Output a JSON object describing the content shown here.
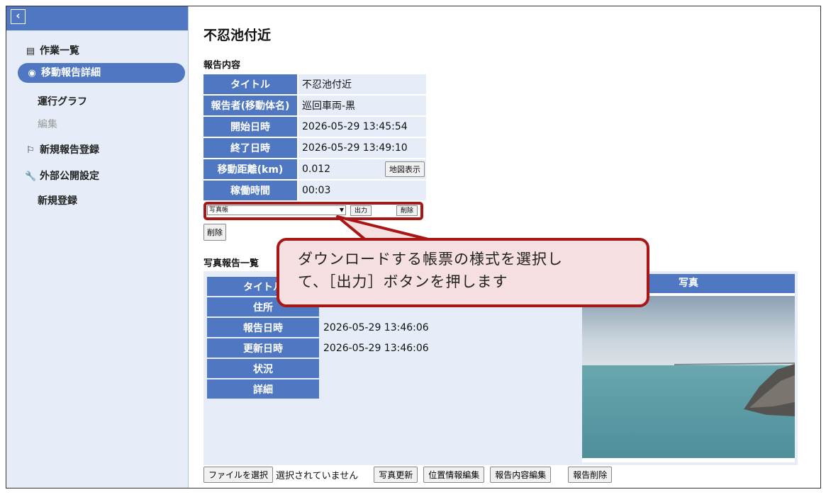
{
  "sidebar": {
    "back_icon": "chevron-left-icon",
    "items": [
      {
        "label": "作業一覧",
        "icon": "list-icon"
      },
      {
        "label": "移動報告詳細",
        "icon": "globe-icon"
      },
      {
        "label": "運行グラフ"
      },
      {
        "label": "編集"
      },
      {
        "label": "新規報告登録",
        "icon": "flag-icon"
      },
      {
        "label": "外部公開設定",
        "icon": "wrench-icon"
      },
      {
        "label": "新規登録"
      }
    ]
  },
  "page": {
    "title": "不忍池付近"
  },
  "report": {
    "section_title": "報告内容",
    "rows": [
      {
        "key": "タイトル",
        "value": "不忍池付近"
      },
      {
        "key": "報告者(移動体名)",
        "value": "巡回車両-黒"
      },
      {
        "key": "開始日時",
        "value": "2026-05-29 13:45:54"
      },
      {
        "key": "終了日時",
        "value": "2026-05-29 13:49:10"
      },
      {
        "key": "移動距離(km)",
        "value": "0.012"
      },
      {
        "key": "稼働時間",
        "value": "00:03"
      }
    ],
    "map_button": "地図表示"
  },
  "export": {
    "selected": "写真帳",
    "output_button": "出力",
    "delete_button": "削除"
  },
  "delete_button": "削除",
  "photo_report": {
    "section_title": "写真報告一覧",
    "rows": [
      {
        "key": "タイトル",
        "value": ""
      },
      {
        "key": "住所",
        "value": ""
      },
      {
        "key": "報告日時",
        "value": "2026-05-29 13:46:06"
      },
      {
        "key": "更新日時",
        "value": "2026-05-29 13:46:06"
      },
      {
        "key": "状況",
        "value": ""
      },
      {
        "key": "詳細",
        "value": ""
      }
    ],
    "photo_header": "写真"
  },
  "bottom": {
    "choose_file": "ファイルを選択",
    "file_status": "選択されていません",
    "update_photo": "写真更新",
    "edit_location": "位置情報編集",
    "edit_report": "報告内容編集",
    "delete_report": "報告削除"
  },
  "callout": {
    "line1": "ダウンロードする帳票の様式を選択し",
    "line2": "て、［出力］ボタンを押します"
  },
  "colors": {
    "accent": "#4f77c2",
    "panel": "#e6edf8",
    "highlight": "#a81616",
    "callout_bg": "#f6dfe0"
  }
}
